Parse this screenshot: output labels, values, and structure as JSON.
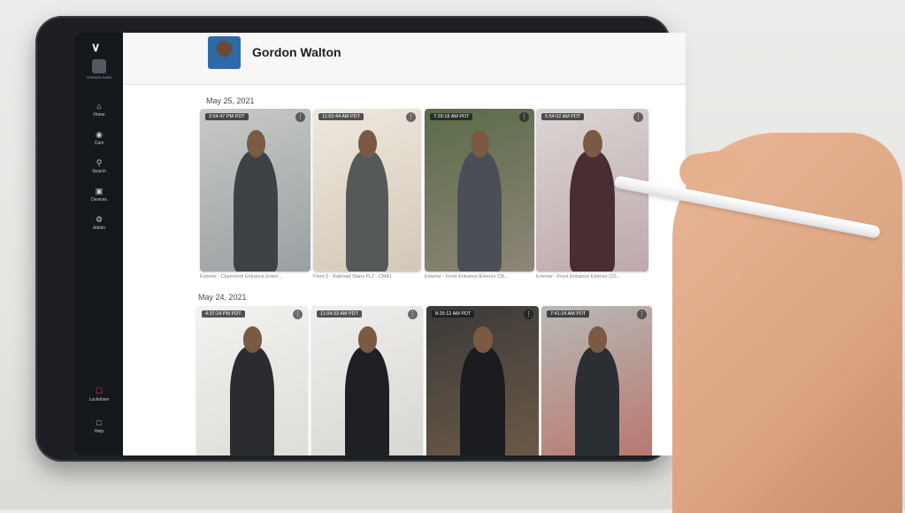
{
  "sidebar": {
    "org_label": "Verkada Sales",
    "items": [
      {
        "label": "Home",
        "icon": "home-icon"
      },
      {
        "label": "Cam",
        "icon": "camera-icon"
      },
      {
        "label": "Search",
        "icon": "search-icon"
      },
      {
        "label": "Devices",
        "icon": "devices-icon"
      },
      {
        "label": "Admin",
        "icon": "admin-icon"
      }
    ],
    "lockdown_label": "Lockdown",
    "help_label": "Help"
  },
  "header": {
    "person_name": "Gordon Walton"
  },
  "groups": [
    {
      "date": "May 25, 2021",
      "cards": [
        {
          "timestamp": "3:54:47 PM PDT",
          "camera": "Exterior - Claremont Entrance Exteri..."
        },
        {
          "timestamp": "11:02:44 AM PDT",
          "camera": "Floor 2 - Railroad Stairs FL2 - CM41"
        },
        {
          "timestamp": "7:29:18 AM PDT",
          "camera": "Exterior - Front Entrance Exterior CB..."
        },
        {
          "timestamp": "5:54:02 AM PDT",
          "camera": "Exterior - Front Entrance Exterior CO..."
        }
      ]
    },
    {
      "date": "May 24, 2021",
      "cards": [
        {
          "timestamp": "4:37:24 PM PDT",
          "camera": ""
        },
        {
          "timestamp": "11:04:33 AM PDT",
          "camera": ""
        },
        {
          "timestamp": "8:25:12 AM PDT",
          "camera": ""
        },
        {
          "timestamp": "7:41:24 AM PDT",
          "camera": ""
        }
      ]
    }
  ],
  "colors": {
    "sidebar_bg": "#14171c",
    "lockdown_red": "#e0443a",
    "header_bg": "#f7f7f8"
  }
}
